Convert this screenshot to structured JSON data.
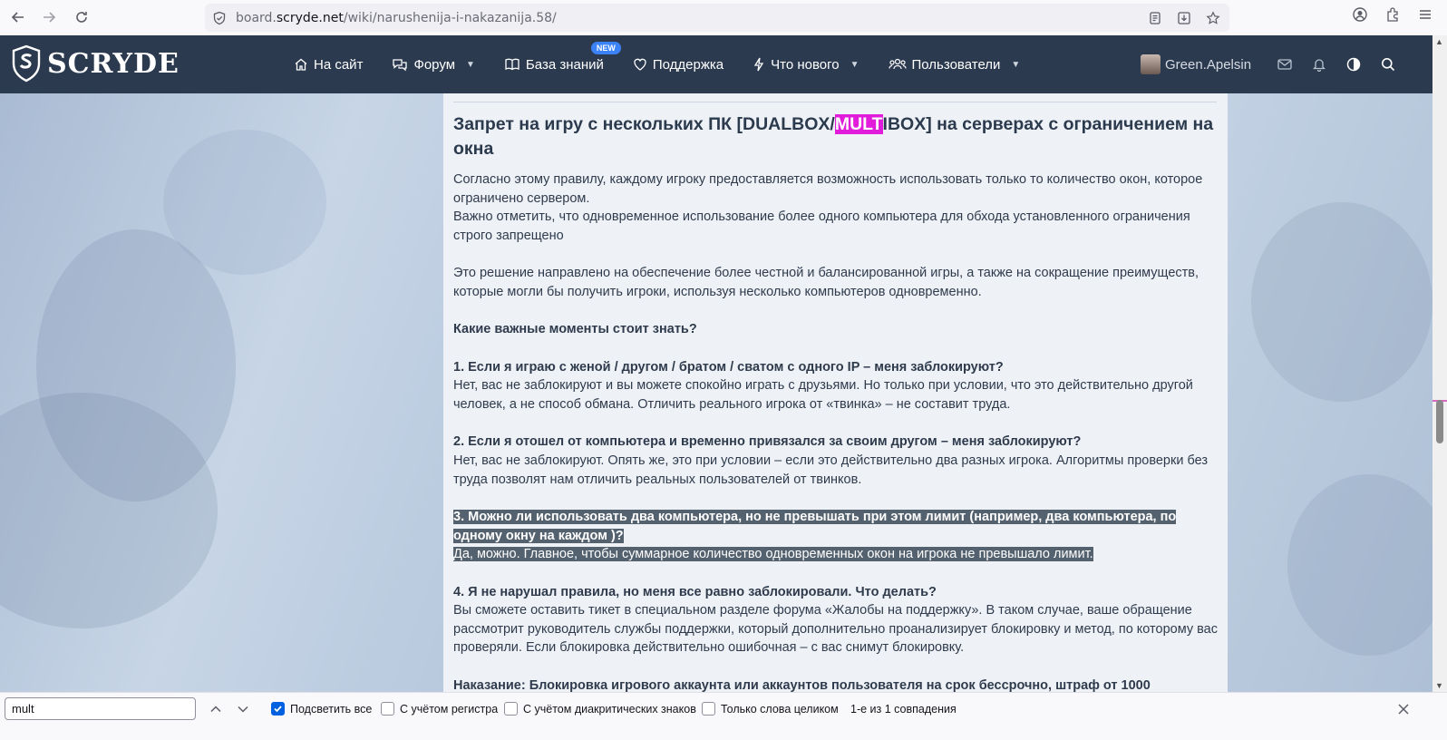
{
  "browser": {
    "url_prefix": "board.",
    "url_domain": "scryde.net",
    "url_path": "/wiki/narushenija-i-nakazanija.58/"
  },
  "header": {
    "logo_text": "SCRYDE",
    "nav": [
      {
        "label": "На сайт",
        "icon": "home-icon"
      },
      {
        "label": "Форум",
        "icon": "comments-icon",
        "dropdown": true
      },
      {
        "label": "База знаний",
        "icon": "book-icon",
        "badge": "NEW"
      },
      {
        "label": "Поддержка",
        "icon": "heart-icon"
      },
      {
        "label": "Что нового",
        "icon": "bolt-icon",
        "dropdown": true
      },
      {
        "label": "Пользователи",
        "icon": "users-icon",
        "dropdown": true
      }
    ],
    "username": "Green.Apelsin"
  },
  "article": {
    "title_before": "Запрет на игру с нескольких ПК [DUALBOX/",
    "title_highlight": "MULT",
    "title_after": "IBOX] на серверах с ограничением на окна",
    "p1_line1": "Согласно этому правилу, каждому игроку предоставляется возможность использовать только то количество окон, которое ограничено сервером.",
    "p1_line2": "Важно отметить, что одновременное использование более одного компьютера для обхода установленного ограничения строго запрещено",
    "p2": "Это решение направлено на обеспечение более честной и балансированной игры, а также на сокращение преимуществ, которые могли бы получить игроки, используя несколько компьютеров одновременно.",
    "q_heading": "Какие важные моменты стоит знать?",
    "q1": "1. Если я играю с женой / другом / братом / сватом с одного IP – меня заблокируют?",
    "a1": "Нет, вас не заблокируют и вы можете спокойно играть с друзьями. Но только при условии, что это действительно другой человек, а не способ обмана. Отличить реального игрока от «твинка» – не составит труда.",
    "q2": "2. Если я отошел от компьютера и временно привязался за своим другом – меня заблокируют?",
    "a2": "Нет, вас не заблокируют. Опять же, это при условии – если это действительно два разных игрока. Алгоритмы проверки без труда позволят нам отличить реальных пользователей от твинков.",
    "q3_line1": "3. Можно ли использовать два компьютера, но не превышать при этом лимит (например, два компьютера, по",
    "q3_line2": "одному окну на каждом )?",
    "a3": "Да, можно. Главное, чтобы суммарное количество одновременных окон на игрока не превышало лимит.",
    "q4": "4. Я не нарушал правила, но меня все равно заблокировали. Что делать?",
    "a4": "Вы сможете оставить тикет в специальном разделе форума «Жалобы на поддержку». В таком случае, ваше обращение рассмотрит руководитель службы поддержки, который дополнительно проанализирует блокировку и метод, по которому вас проверяли. Если блокировка действительно ошибочная – с вас снимут блокировку.",
    "punishment": "Наказание: Блокировка игрового аккаунта или аккаунтов пользователя на срок бессрочно, штраф от 1000"
  },
  "find_bar": {
    "query": "mult",
    "highlight_all": "Подсветить все",
    "match_case": "С учётом регистра",
    "diacritics": "С учётом диакритических знаков",
    "whole_words": "Только слова целиком",
    "result": "1-е из 1 совпадения"
  },
  "colors": {
    "header_bg": "#2b3a4f",
    "highlight": "#e11cdb",
    "selection": "#54616f",
    "badge": "#3b82f6"
  }
}
